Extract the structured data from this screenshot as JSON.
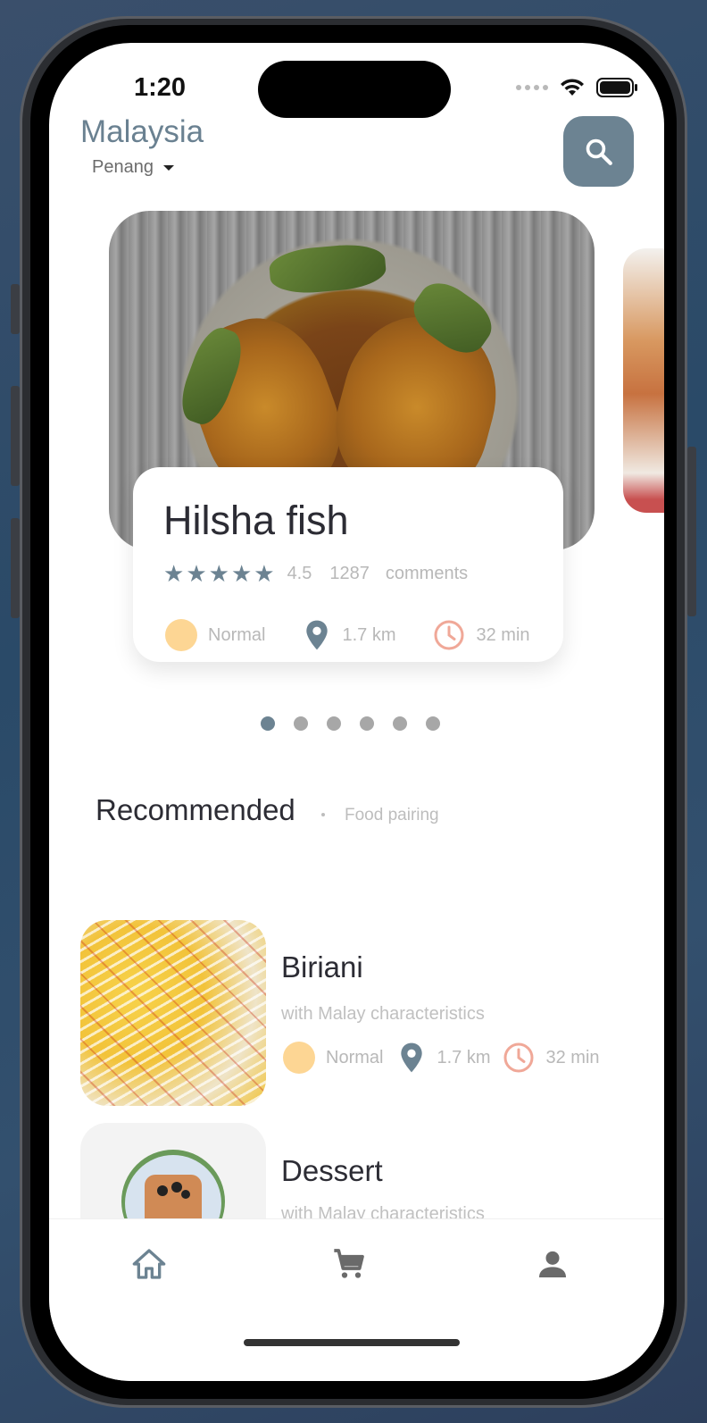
{
  "status_bar": {
    "time": "1:20"
  },
  "header": {
    "country": "Malaysia",
    "city": "Penang"
  },
  "featured": {
    "title": "Hilsha fish",
    "rating": "4.5",
    "comment_count": "1287",
    "comments_label": "comments",
    "spice": "Normal",
    "distance": "1.7 km",
    "time": "32 min",
    "star_count": 5
  },
  "pager": {
    "total": 6,
    "active": 1
  },
  "section": {
    "title": "Recommended",
    "subtitle": "Food pairing"
  },
  "list": [
    {
      "title": "Biriani",
      "subtitle": "with Malay characteristics",
      "spice": "Normal",
      "distance": "1.7 km",
      "time": "32 min"
    },
    {
      "title": "Dessert",
      "subtitle": "with Malay characteristics"
    }
  ],
  "colors": {
    "accent": "#6c8392",
    "spice": "#fdd694",
    "clock": "#f0a898",
    "text": "#2c2c34",
    "muted": "#b8b8b8"
  },
  "icons": [
    "search-icon",
    "chevron-down-icon",
    "star-icon",
    "location-pin-icon",
    "clock-icon",
    "home-icon",
    "cart-icon",
    "person-icon"
  ]
}
